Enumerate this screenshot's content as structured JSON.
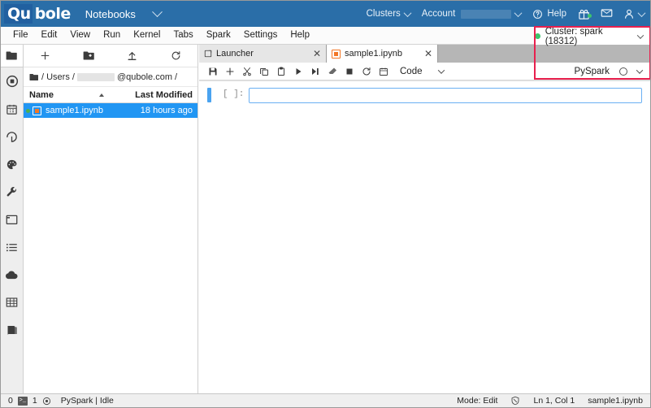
{
  "header": {
    "logo_part1": "Qu",
    "logo_part2": "bole",
    "product": "Notebooks",
    "clusters_label": "Clusters",
    "account_label": "Account",
    "help_label": "Help",
    "icons": {
      "product_chevron": "chevron-down-icon",
      "clusters_chevron": "chevron-down-icon",
      "account_chevron": "chevron-down-icon",
      "help": "help-circle-icon",
      "gift": "gift-icon",
      "feedback": "feedback-flag-icon",
      "user": "user-icon",
      "user_chevron": "chevron-down-icon"
    },
    "brand_color": "#2a6ea8"
  },
  "menubar": {
    "items": [
      {
        "label": "File"
      },
      {
        "label": "Edit"
      },
      {
        "label": "View"
      },
      {
        "label": "Run"
      },
      {
        "label": "Kernel"
      },
      {
        "label": "Tabs"
      },
      {
        "label": "Spark"
      },
      {
        "label": "Settings"
      },
      {
        "label": "Help"
      }
    ]
  },
  "cluster_bar": {
    "status_label": "Cluster: spark (18312)",
    "status_color": "#3ec46d",
    "chevron": "chevron-down-icon",
    "highlight_color": "#e8204e"
  },
  "sidebar": {
    "items": [
      {
        "icon": "folder-icon",
        "name": "file-browser",
        "active": true
      },
      {
        "icon": "running-terminals-icon",
        "name": "running"
      },
      {
        "icon": "calendar-icon",
        "name": "scheduler"
      },
      {
        "icon": "git-icon",
        "name": "git"
      },
      {
        "icon": "palette-icon",
        "name": "theme"
      },
      {
        "icon": "wrench-icon",
        "name": "tools"
      },
      {
        "icon": "window-icon",
        "name": "window"
      },
      {
        "icon": "list-icon",
        "name": "toc"
      },
      {
        "icon": "cloud-icon",
        "name": "cloud"
      },
      {
        "icon": "table-icon",
        "name": "tables"
      },
      {
        "icon": "book-icon",
        "name": "docs"
      }
    ]
  },
  "file_browser": {
    "toolbar": [
      {
        "icon": "new-launcher-plus-icon",
        "label": "New Launcher"
      },
      {
        "icon": "new-folder-icon",
        "label": "New Folder"
      },
      {
        "icon": "upload-icon",
        "label": "Upload"
      },
      {
        "icon": "refresh-icon",
        "label": "Refresh"
      }
    ],
    "breadcrumb": {
      "home_icon": "folder-icon",
      "segment1": "/ Users /",
      "segment2_blurred": true,
      "segment3": "@qubole.com /"
    },
    "columns": [
      {
        "label": "Name",
        "sort": "asc"
      },
      {
        "label": "Last Modified"
      }
    ],
    "rows": [
      {
        "name": "sample1.ipynb",
        "modified": "18 hours ago",
        "selected": true,
        "running_dot": "#4caf50",
        "icon": "notebook-icon"
      }
    ],
    "selection_color": "#2196f3"
  },
  "notebook": {
    "tabs": [
      {
        "label": "Launcher",
        "icon": "launcher-icon",
        "active": false,
        "close": "close-icon"
      },
      {
        "label": "sample1.ipynb",
        "icon": "notebook-icon",
        "active": true,
        "close": "close-icon"
      }
    ],
    "toolbar": [
      {
        "icon": "save-icon",
        "label": "Save"
      },
      {
        "icon": "add-cell-icon",
        "label": "Insert cell"
      },
      {
        "icon": "cut-icon",
        "label": "Cut"
      },
      {
        "icon": "copy-icon",
        "label": "Copy"
      },
      {
        "icon": "paste-icon",
        "label": "Paste"
      },
      {
        "icon": "run-icon",
        "label": "Run"
      },
      {
        "icon": "run-all-icon",
        "label": "Run all"
      },
      {
        "icon": "clear-icon",
        "label": "Clear outputs"
      },
      {
        "icon": "stop-icon",
        "label": "Interrupt"
      },
      {
        "icon": "restart-icon",
        "label": "Restart"
      },
      {
        "icon": "schedule-icon",
        "label": "Schedule"
      }
    ],
    "cell_type": "Code",
    "cell_type_chevron": "chevron-down-icon",
    "kernel_name": "PySpark",
    "kernel_busy_icon": "kernel-idle-circle-icon",
    "kernel_chevron": "chevron-down-icon",
    "cells": [
      {
        "prompt": "[ ]:",
        "source": "",
        "active": true
      }
    ]
  },
  "statusbar": {
    "terminals_count": "0",
    "terminal_icon": "terminal-icon",
    "kernels_count": "1",
    "kernel_icon": "kernel-icon",
    "kernel_status": "PySpark | Idle",
    "mode": "Mode: Edit",
    "notifications_icon": "notification-off-icon",
    "cursor_position": "Ln 1, Col 1",
    "filename": "sample1.ipynb"
  }
}
